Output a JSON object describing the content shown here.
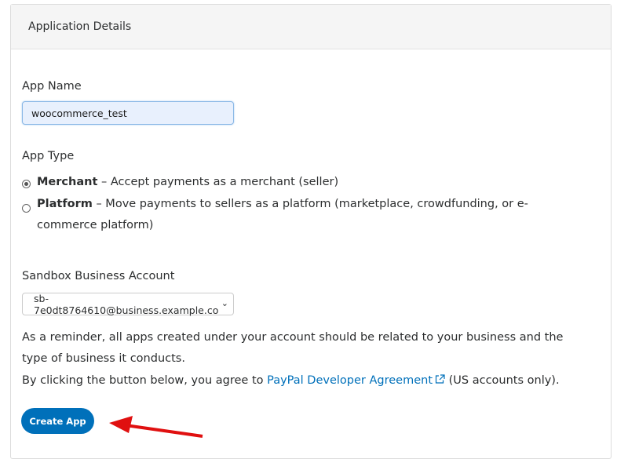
{
  "card": {
    "title": "Application Details"
  },
  "app_name": {
    "label": "App Name",
    "value": "woocommerce_test"
  },
  "app_type": {
    "label": "App Type",
    "options": [
      {
        "name": "Merchant",
        "desc": " – Accept payments as a merchant (seller)",
        "selected": true
      },
      {
        "name": "Platform",
        "desc": " – Move payments to sellers as a platform (marketplace, crowdfunding, or e-commerce platform)",
        "selected": false
      }
    ]
  },
  "sandbox": {
    "label": "Sandbox Business Account",
    "value": "sb-7e0dt8764610@business.example.co"
  },
  "reminder": "As a reminder, all apps created under your account should be related to your business and the type of business it conducts.",
  "agreement": {
    "prefix": "By clicking the button below, you agree to ",
    "link": "PayPal Developer Agreement",
    "suffix": " (US accounts only)."
  },
  "create_button": "Create App",
  "colors": {
    "primary": "#0070ba",
    "annotation_arrow": "#e01010"
  }
}
